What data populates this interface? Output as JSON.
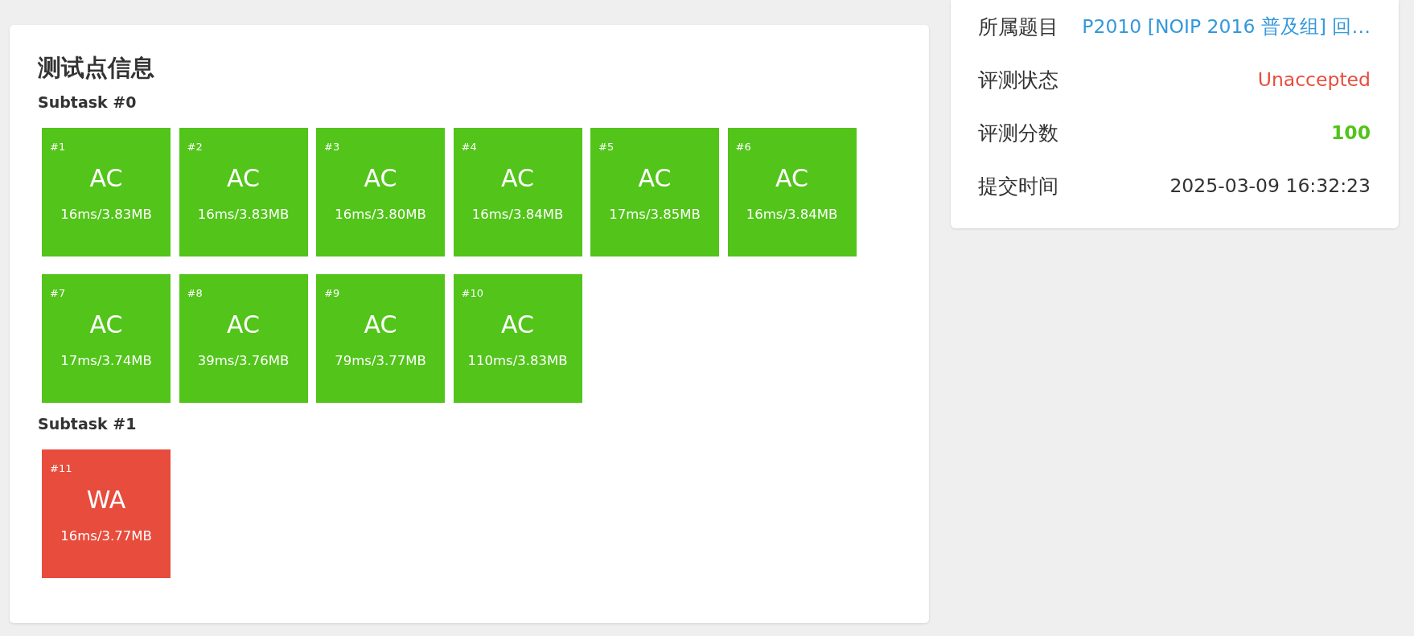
{
  "testcases": {
    "title": "测试点信息",
    "subtasks": [
      {
        "title": "Subtask #0",
        "cases": [
          {
            "id": "#1",
            "verdict": "AC",
            "usage": "16ms/3.83MB",
            "color": "#52c41a"
          },
          {
            "id": "#2",
            "verdict": "AC",
            "usage": "16ms/3.83MB",
            "color": "#52c41a"
          },
          {
            "id": "#3",
            "verdict": "AC",
            "usage": "16ms/3.80MB",
            "color": "#52c41a"
          },
          {
            "id": "#4",
            "verdict": "AC",
            "usage": "16ms/3.84MB",
            "color": "#52c41a"
          },
          {
            "id": "#5",
            "verdict": "AC",
            "usage": "17ms/3.85MB",
            "color": "#52c41a"
          },
          {
            "id": "#6",
            "verdict": "AC",
            "usage": "16ms/3.84MB",
            "color": "#52c41a"
          },
          {
            "id": "#7",
            "verdict": "AC",
            "usage": "17ms/3.74MB",
            "color": "#52c41a"
          },
          {
            "id": "#8",
            "verdict": "AC",
            "usage": "39ms/3.76MB",
            "color": "#52c41a"
          },
          {
            "id": "#9",
            "verdict": "AC",
            "usage": "79ms/3.77MB",
            "color": "#52c41a"
          },
          {
            "id": "#10",
            "verdict": "AC",
            "usage": "110ms/3.83MB",
            "color": "#52c41a"
          }
        ]
      },
      {
        "title": "Subtask #1",
        "cases": [
          {
            "id": "#11",
            "verdict": "WA",
            "usage": "16ms/3.77MB",
            "color": "#e74c3c"
          }
        ]
      }
    ]
  },
  "submission_info": {
    "rows": [
      {
        "label": "所属题目",
        "value": "P2010 [NOIP 2016 普及组] 回…",
        "kind": "link"
      },
      {
        "label": "评测状态",
        "value": "Unaccepted",
        "kind": "status"
      },
      {
        "label": "评测分数",
        "value": "100",
        "kind": "score"
      },
      {
        "label": "提交时间",
        "value": "2025-03-09 16:32:23",
        "kind": "text"
      }
    ]
  }
}
